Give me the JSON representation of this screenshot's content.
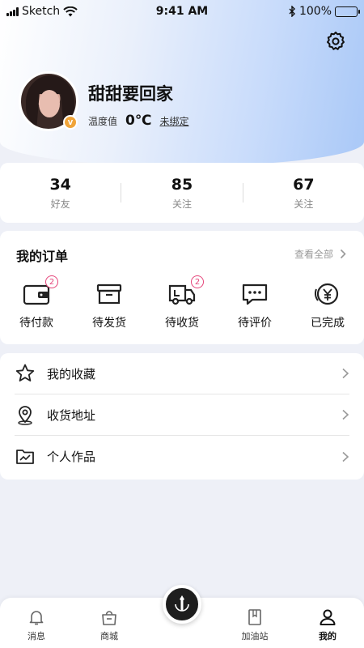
{
  "status_bar": {
    "carrier": "Sketch",
    "time": "9:41 AM",
    "battery": "100%"
  },
  "profile": {
    "username": "甜甜要回家",
    "temperature_label": "温度值",
    "temperature_value": "0℃",
    "bind_link": "未绑定"
  },
  "stats": [
    {
      "value": "34",
      "label": "好友"
    },
    {
      "value": "85",
      "label": "关注"
    },
    {
      "value": "67",
      "label": "关注"
    }
  ],
  "orders": {
    "title": "我的订单",
    "view_all": "查看全部",
    "items": [
      {
        "label": "待付款",
        "icon": "wallet-icon",
        "badge": "2"
      },
      {
        "label": "待发货",
        "icon": "box-icon",
        "badge": ""
      },
      {
        "label": "待收货",
        "icon": "truck-icon",
        "badge": "2"
      },
      {
        "label": "待评价",
        "icon": "comment-icon",
        "badge": ""
      },
      {
        "label": "已完成",
        "icon": "yuan-icon",
        "badge": ""
      }
    ]
  },
  "menu": [
    {
      "label": "我的收藏",
      "icon": "star-icon"
    },
    {
      "label": "收货地址",
      "icon": "location-icon"
    },
    {
      "label": "个人作品",
      "icon": "folder-icon"
    }
  ],
  "tabbar": {
    "items": [
      {
        "label": "消息",
        "icon": "bell-icon"
      },
      {
        "label": "商城",
        "icon": "shop-bag-icon"
      },
      {
        "label": "加油站",
        "icon": "book-icon"
      },
      {
        "label": "我的",
        "icon": "user-icon"
      }
    ],
    "active": "我的"
  },
  "colors": {
    "accent_badge": "#e5457a",
    "header_gradient_end": "#a9c8f7",
    "vip_badge": "#f0a43a"
  }
}
